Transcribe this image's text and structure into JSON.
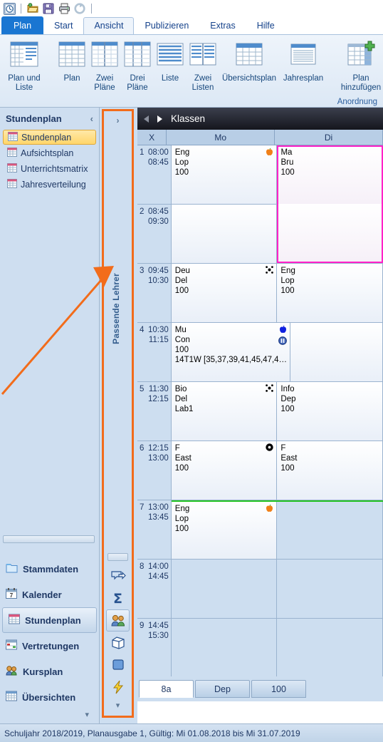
{
  "quick_access": {
    "buttons": [
      {
        "name": "untis-logo-icon",
        "label": "Untis"
      },
      {
        "name": "open-folder-icon",
        "label": "Öffnen"
      },
      {
        "name": "save-icon",
        "label": "Speichern"
      },
      {
        "name": "print-icon",
        "label": "Drucken"
      },
      {
        "name": "refresh-icon",
        "label": "Aktualisieren"
      }
    ]
  },
  "ribbon": {
    "tabs": [
      {
        "label": "Plan",
        "type": "file"
      },
      {
        "label": "Start",
        "type": "normal"
      },
      {
        "label": "Ansicht",
        "type": "active"
      },
      {
        "label": "Publizieren",
        "type": "normal"
      },
      {
        "label": "Extras",
        "type": "normal"
      },
      {
        "label": "Hilfe",
        "type": "normal"
      }
    ],
    "buttons": [
      {
        "label": "Plan und\nListe",
        "icon": "plan-and-list-icon"
      },
      {
        "label": "Plan",
        "icon": "plan-icon"
      },
      {
        "label": "Zwei\nPläne",
        "icon": "two-plans-icon"
      },
      {
        "label": "Drei\nPläne",
        "icon": "three-plans-icon"
      },
      {
        "label": "Liste",
        "icon": "list-icon"
      },
      {
        "label": "Zwei\nListen",
        "icon": "two-lists-icon"
      },
      {
        "label": "Übersichtsplan",
        "icon": "overview-plan-icon"
      },
      {
        "label": "Jahresplan",
        "icon": "year-plan-icon"
      },
      {
        "label": "Plan\nhinzufügen",
        "icon": "add-plan-icon"
      }
    ],
    "group_label": "Anordnung"
  },
  "sidebar": {
    "title": "Stundenplan",
    "collapse_chevron": "‹",
    "items": [
      {
        "label": "Stundenplan",
        "icon": "grid-icon",
        "selected": true
      },
      {
        "label": "Aufsichtsplan",
        "icon": "grid-icon",
        "selected": false
      },
      {
        "label": "Unterrichtsmatrix",
        "icon": "grid-icon",
        "selected": false
      },
      {
        "label": "Jahresverteilung",
        "icon": "grid-icon",
        "selected": false
      }
    ],
    "nav": [
      {
        "label": "Stammdaten",
        "icon": "folder-icon",
        "selected": false
      },
      {
        "label": "Kalender",
        "icon": "calendar-icon",
        "selected": false
      },
      {
        "label": "Stundenplan",
        "icon": "grid-icon",
        "selected": true
      },
      {
        "label": "Vertretungen",
        "icon": "substitution-icon",
        "selected": false
      },
      {
        "label": "Kursplan",
        "icon": "people-icon",
        "selected": false
      },
      {
        "label": "Übersichten",
        "icon": "overview-icon",
        "selected": false
      }
    ],
    "more_chevron": "▾"
  },
  "vertical_panel": {
    "expand_chevron": "›",
    "title": "Passende Lehrer",
    "highlight_color": "#f26c1b",
    "buttons": [
      {
        "icon": "speech-bubble-arrow-icon",
        "selected": false
      },
      {
        "icon": "sigma-icon",
        "selected": false
      },
      {
        "icon": "people-icon",
        "selected": true
      },
      {
        "icon": "cube-icon",
        "selected": false
      },
      {
        "icon": "blue-square-icon",
        "selected": false
      },
      {
        "icon": "lightning-icon",
        "selected": false
      }
    ],
    "more_chevron": "▾"
  },
  "timetable": {
    "title": "Klassen",
    "prev_icon": "prev-triangle-icon",
    "next_icon": "next-triangle-icon",
    "columns": [
      "X",
      "Mo",
      "Di"
    ],
    "rows": [
      {
        "num": "1",
        "start": "08:00",
        "end": "08:45",
        "cells": [
          {
            "lines": [
              "Eng",
              "Lop",
              "100"
            ],
            "icons": [
              "orange-apple-icon"
            ],
            "state": "filled"
          },
          {
            "lines": [
              "Ma",
              "Bru",
              "100"
            ],
            "icons": [],
            "state": "selected"
          }
        ]
      },
      {
        "num": "2",
        "start": "08:45",
        "end": "09:30",
        "cells": [
          {
            "lines": [],
            "icons": [],
            "state": "filled"
          },
          {
            "lines": [],
            "icons": [],
            "state": "selected-continue"
          }
        ]
      },
      {
        "num": "3",
        "start": "09:45",
        "end": "10:30",
        "cells": [
          {
            "lines": [
              "Deu",
              "Del",
              "100"
            ],
            "icons": [
              "cluster-icon"
            ],
            "state": "filled"
          },
          {
            "lines": [
              "Eng",
              "Lop",
              "100"
            ],
            "icons": [],
            "state": "filled"
          }
        ]
      },
      {
        "num": "4",
        "start": "10:30",
        "end": "11:15",
        "cells": [
          {
            "lines": [
              "Mu",
              "Con",
              "100",
              "14T1W  [35,37,39,41,45,47,4…"
            ],
            "icons": [
              "blue-apple-icon",
              "pause-circle-icon"
            ],
            "state": "filled"
          },
          {
            "lines": [],
            "icons": [],
            "state": "filled"
          }
        ]
      },
      {
        "num": "5",
        "start": "11:30",
        "end": "12:15",
        "cells": [
          {
            "lines": [
              "Bio",
              "Del",
              "Lab1"
            ],
            "icons": [
              "cluster-icon"
            ],
            "state": "filled"
          },
          {
            "lines": [
              "Info",
              "Dep",
              "100"
            ],
            "icons": [],
            "state": "filled"
          }
        ]
      },
      {
        "num": "6",
        "start": "12:15",
        "end": "13:00",
        "cells": [
          {
            "lines": [
              "F",
              "East",
              "100"
            ],
            "icons": [
              "black-dot-icon"
            ],
            "state": "filled"
          },
          {
            "lines": [
              "F",
              "East",
              "100"
            ],
            "icons": [],
            "state": "filled"
          }
        ]
      },
      {
        "num": "7",
        "start": "13:00",
        "end": "13:45",
        "green_divider": true,
        "cells": [
          {
            "lines": [
              "Eng",
              "Lop",
              "100"
            ],
            "icons": [
              "orange-apple-icon"
            ],
            "state": "filled"
          },
          {
            "lines": [],
            "icons": [],
            "state": "empty"
          }
        ]
      },
      {
        "num": "8",
        "start": "14:00",
        "end": "14:45",
        "cells": [
          {
            "lines": [],
            "icons": [],
            "state": "empty"
          },
          {
            "lines": [],
            "icons": [],
            "state": "empty"
          }
        ]
      },
      {
        "num": "9",
        "start": "14:45",
        "end": "15:30",
        "cells": [
          {
            "lines": [],
            "icons": [],
            "state": "empty"
          },
          {
            "lines": [],
            "icons": [],
            "state": "empty"
          }
        ]
      }
    ],
    "bottom_tabs": [
      {
        "label": "8a",
        "active": true
      },
      {
        "label": "Dep",
        "active": false
      },
      {
        "label": "100",
        "active": false
      }
    ]
  },
  "status_bar": {
    "text": "Schuljahr 2018/2019, Planausgabe 1, Gültig: Mi 01.08.2018 bis Mi 31.07.2019"
  }
}
